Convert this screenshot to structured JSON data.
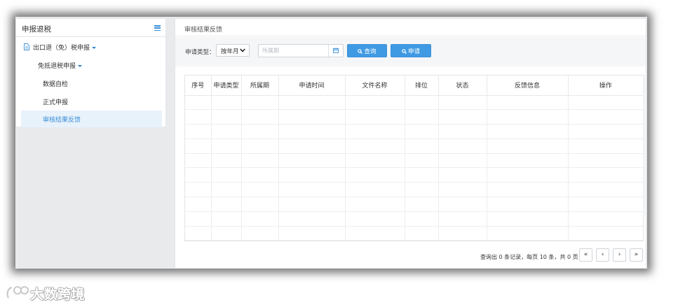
{
  "sidebar": {
    "title": "申报退税",
    "menu_icon": "hamburger-menu-icon",
    "items": [
      {
        "label": "出口退（免）税申报",
        "icon": "document-icon",
        "has_caret": true
      },
      {
        "label": "免抵退税申报",
        "has_caret": true
      },
      {
        "label": "数据自检"
      },
      {
        "label": "正式申报"
      },
      {
        "label": "审核结果反馈",
        "active": true
      }
    ]
  },
  "main": {
    "title": "审核结果反馈",
    "filter": {
      "label": "申请类型：",
      "type_value": "按年月",
      "period_placeholder": "所属期",
      "calendar_icon": "calendar-icon",
      "query_label": "查询",
      "apply_label": "申请"
    },
    "table": {
      "columns": [
        "序号",
        "申请类型",
        "所属期",
        "申请时间",
        "文件名称",
        "排位",
        "状态",
        "反馈信息",
        "操作"
      ],
      "rows": []
    },
    "pagination": {
      "info": "查询出 0 条记录，每页 10 条，共 0 页",
      "first": "«",
      "prev": "‹",
      "next": "›",
      "last": "»"
    }
  },
  "watermark": {
    "text": "大数跨境"
  },
  "colors": {
    "accent": "#3f9ae3",
    "active_bg": "#e8f2fb"
  }
}
